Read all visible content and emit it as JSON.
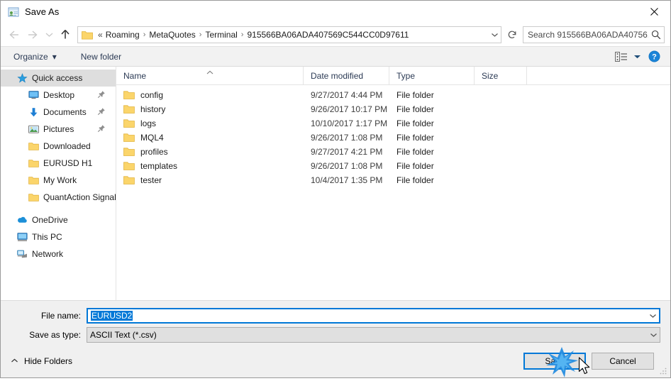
{
  "window": {
    "title": "Save As",
    "app_icon": "save-as-icon",
    "close_label": "✕"
  },
  "nav": {
    "back_icon": "back-arrow-icon",
    "forward_icon": "forward-arrow-icon",
    "recent_icon": "recent-locations-chevron-icon",
    "up_icon": "up-arrow-icon",
    "refresh_icon": "refresh-icon",
    "address_prefix": "«",
    "breadcrumbs": [
      "Roaming",
      "MetaQuotes",
      "Terminal",
      "915566BA06ADA407569C544CC0D97611"
    ],
    "separator": "›",
    "dropdown_icon": "chevron-down-icon"
  },
  "search": {
    "placeholder": "Search 915566BA06ADA40756...",
    "icon": "search-icon"
  },
  "toolbar": {
    "organize_label": "Organize",
    "organize_caret": "▾",
    "new_folder_label": "New folder",
    "view_icon": "view-layout-icon",
    "view_caret": "▾",
    "help_icon": "help-icon"
  },
  "sidebar": {
    "items": [
      {
        "label": "Quick access",
        "icon": "star-icon",
        "selected": true,
        "indent": 0,
        "pinned": false
      },
      {
        "label": "Desktop",
        "icon": "desktop-icon",
        "selected": false,
        "indent": 1,
        "pinned": true
      },
      {
        "label": "Documents",
        "icon": "documents-download-icon",
        "selected": false,
        "indent": 1,
        "pinned": true
      },
      {
        "label": "Pictures",
        "icon": "pictures-icon",
        "selected": false,
        "indent": 1,
        "pinned": true
      },
      {
        "label": "Downloaded",
        "icon": "folder-icon",
        "selected": false,
        "indent": 1,
        "pinned": false
      },
      {
        "label": "EURUSD H1",
        "icon": "folder-icon",
        "selected": false,
        "indent": 1,
        "pinned": false
      },
      {
        "label": "My Work",
        "icon": "folder-icon",
        "selected": false,
        "indent": 1,
        "pinned": false
      },
      {
        "label": "QuantAction Signal",
        "icon": "folder-icon",
        "selected": false,
        "indent": 1,
        "pinned": false
      },
      {
        "label": "OneDrive",
        "icon": "onedrive-cloud-icon",
        "selected": false,
        "indent": 0,
        "pinned": false
      },
      {
        "label": "This PC",
        "icon": "this-pc-icon",
        "selected": false,
        "indent": 0,
        "pinned": false
      },
      {
        "label": "Network",
        "icon": "network-icon",
        "selected": false,
        "indent": 0,
        "pinned": false
      }
    ]
  },
  "filelist": {
    "columns": [
      {
        "label": "Name",
        "sorted": "asc"
      },
      {
        "label": "Date modified",
        "sorted": ""
      },
      {
        "label": "Type",
        "sorted": ""
      },
      {
        "label": "Size",
        "sorted": ""
      }
    ],
    "rows": [
      {
        "name": "config",
        "date": "9/27/2017 4:44 PM",
        "type": "File folder",
        "size": ""
      },
      {
        "name": "history",
        "date": "9/26/2017 10:17 PM",
        "type": "File folder",
        "size": ""
      },
      {
        "name": "logs",
        "date": "10/10/2017 1:17 PM",
        "type": "File folder",
        "size": ""
      },
      {
        "name": "MQL4",
        "date": "9/26/2017 1:08 PM",
        "type": "File folder",
        "size": ""
      },
      {
        "name": "profiles",
        "date": "9/27/2017 4:21 PM",
        "type": "File folder",
        "size": ""
      },
      {
        "name": "templates",
        "date": "9/26/2017 1:08 PM",
        "type": "File folder",
        "size": ""
      },
      {
        "name": "tester",
        "date": "10/4/2017 1:35 PM",
        "type": "File folder",
        "size": ""
      }
    ]
  },
  "form": {
    "filename_label": "File name:",
    "filename_value": "EURUSD2",
    "savetype_label": "Save as type:",
    "savetype_value": "ASCII Text (*.csv)",
    "dropdown_icon": "chevron-down-icon"
  },
  "footer": {
    "hide_folders_label": "Hide Folders",
    "hide_folders_caret": "˄",
    "save_label": "Save",
    "cancel_label": "Cancel",
    "resize_grip": "resize-grip-icon"
  },
  "colors": {
    "accent": "#0078d7",
    "folder": "#fbd56b",
    "selection": "#dedede",
    "toolbar_bg": "#f2f2f2",
    "form_bg": "#f0f0f0"
  }
}
